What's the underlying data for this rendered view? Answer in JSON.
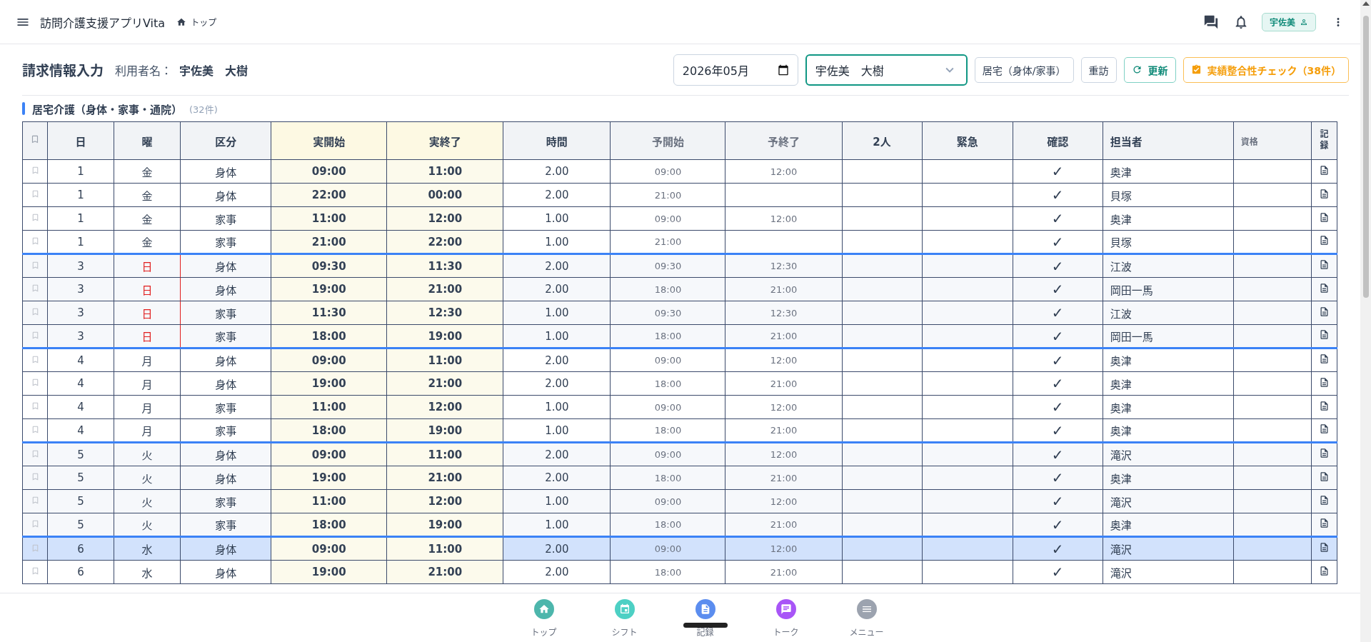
{
  "header": {
    "app_title": "訪問介護支援アプリVita",
    "breadcrumb": "トップ",
    "user_badge": "宇佐美"
  },
  "page": {
    "title": "請求情報入力",
    "user_label": "利用者名：",
    "user_name": "宇佐美　大樹"
  },
  "controls": {
    "month": "2026年05月",
    "user_select": "宇佐美　大樹",
    "buttons": [
      {
        "label": "居宅（身体/家事）",
        "kind": "outline"
      },
      {
        "label": "重訪",
        "kind": "outline"
      },
      {
        "label": "更新",
        "kind": "refresh"
      },
      {
        "label": "実績整合性チェック（38件）",
        "kind": "warning"
      }
    ]
  },
  "section": {
    "title": "居宅介護（身体・家事・通院）",
    "count": "(32件)"
  },
  "table": {
    "columns": [
      {
        "kind": "bookmark"
      },
      {
        "label": "日",
        "kind": "main"
      },
      {
        "label": "曜",
        "kind": "main"
      },
      {
        "label": "区分",
        "kind": "main"
      },
      {
        "label": "実開始",
        "kind": "actual"
      },
      {
        "label": "実終了",
        "kind": "actual"
      },
      {
        "label": "時間",
        "kind": "main"
      },
      {
        "label": "予開始",
        "kind": "plan"
      },
      {
        "label": "予終了",
        "kind": "plan"
      },
      {
        "label": "2人",
        "kind": "main"
      },
      {
        "label": "緊急",
        "kind": "main"
      },
      {
        "label": "確認",
        "kind": "main"
      },
      {
        "label": "担当者",
        "kind": "staff"
      },
      {
        "label": "資格",
        "kind": "minor"
      },
      {
        "label": "記録",
        "kind": "vertical"
      }
    ],
    "rows": [
      {
        "day": "1",
        "weekday": "金",
        "sunday": false,
        "category": "身体",
        "actual_start": "09:00",
        "actual_end": "11:00",
        "hours": "2.00",
        "plan_start": "09:00",
        "plan_end": "12:00",
        "confirmed": "✓",
        "staff": "奥津",
        "selected": false
      },
      {
        "day": "1",
        "weekday": "金",
        "sunday": false,
        "category": "身体",
        "actual_start": "22:00",
        "actual_end": "00:00",
        "hours": "2.00",
        "plan_start": "21:00",
        "confirmed": "✓",
        "staff": "貝塚",
        "selected": false
      },
      {
        "day": "1",
        "weekday": "金",
        "sunday": false,
        "category": "家事",
        "actual_start": "11:00",
        "actual_end": "12:00",
        "hours": "1.00",
        "plan_start": "09:00",
        "plan_end": "12:00",
        "confirmed": "✓",
        "staff": "奥津",
        "selected": false
      },
      {
        "day": "1",
        "weekday": "金",
        "sunday": false,
        "category": "家事",
        "actual_start": "21:00",
        "actual_end": "22:00",
        "hours": "1.00",
        "plan_start": "21:00",
        "confirmed": "✓",
        "staff": "貝塚",
        "selected": false
      },
      {
        "day": "3",
        "weekday": "日",
        "sunday": true,
        "category": "身体",
        "actual_start": "09:30",
        "actual_end": "11:30",
        "hours": "2.00",
        "plan_start": "09:30",
        "plan_end": "12:30",
        "confirmed": "✓",
        "staff": "江波",
        "selected": false
      },
      {
        "day": "3",
        "weekday": "日",
        "sunday": true,
        "category": "身体",
        "actual_start": "19:00",
        "actual_end": "21:00",
        "hours": "2.00",
        "plan_start": "18:00",
        "plan_end": "21:00",
        "confirmed": "✓",
        "staff": "岡田一馬",
        "selected": false
      },
      {
        "day": "3",
        "weekday": "日",
        "sunday": true,
        "category": "家事",
        "actual_start": "11:30",
        "actual_end": "12:30",
        "hours": "1.00",
        "plan_start": "09:30",
        "plan_end": "12:30",
        "confirmed": "✓",
        "staff": "江波",
        "selected": false
      },
      {
        "day": "3",
        "weekday": "日",
        "sunday": true,
        "category": "家事",
        "actual_start": "18:00",
        "actual_end": "19:00",
        "hours": "1.00",
        "plan_start": "18:00",
        "plan_end": "21:00",
        "confirmed": "✓",
        "staff": "岡田一馬",
        "selected": false
      },
      {
        "day": "4",
        "weekday": "月",
        "sunday": false,
        "category": "身体",
        "actual_start": "09:00",
        "actual_end": "11:00",
        "hours": "2.00",
        "plan_start": "09:00",
        "plan_end": "12:00",
        "confirmed": "✓",
        "staff": "奥津",
        "selected": false
      },
      {
        "day": "4",
        "weekday": "月",
        "sunday": false,
        "category": "身体",
        "actual_start": "19:00",
        "actual_end": "21:00",
        "hours": "2.00",
        "plan_start": "18:00",
        "plan_end": "21:00",
        "confirmed": "✓",
        "staff": "奥津",
        "selected": false
      },
      {
        "day": "4",
        "weekday": "月",
        "sunday": false,
        "category": "家事",
        "actual_start": "11:00",
        "actual_end": "12:00",
        "hours": "1.00",
        "plan_start": "09:00",
        "plan_end": "12:00",
        "confirmed": "✓",
        "staff": "奥津",
        "selected": false
      },
      {
        "day": "4",
        "weekday": "月",
        "sunday": false,
        "category": "家事",
        "actual_start": "18:00",
        "actual_end": "19:00",
        "hours": "1.00",
        "plan_start": "18:00",
        "plan_end": "21:00",
        "confirmed": "✓",
        "staff": "奥津",
        "selected": false
      },
      {
        "day": "5",
        "weekday": "火",
        "sunday": false,
        "category": "身体",
        "actual_start": "09:00",
        "actual_end": "11:00",
        "hours": "2.00",
        "plan_start": "09:00",
        "plan_end": "12:00",
        "confirmed": "✓",
        "staff": "滝沢",
        "selected": false
      },
      {
        "day": "5",
        "weekday": "火",
        "sunday": false,
        "category": "身体",
        "actual_start": "19:00",
        "actual_end": "21:00",
        "hours": "2.00",
        "plan_start": "18:00",
        "plan_end": "21:00",
        "confirmed": "✓",
        "staff": "奥津",
        "selected": false
      },
      {
        "day": "5",
        "weekday": "火",
        "sunday": false,
        "category": "家事",
        "actual_start": "11:00",
        "actual_end": "12:00",
        "hours": "1.00",
        "plan_start": "09:00",
        "plan_end": "12:00",
        "confirmed": "✓",
        "staff": "滝沢",
        "selected": false
      },
      {
        "day": "5",
        "weekday": "火",
        "sunday": false,
        "category": "家事",
        "actual_start": "18:00",
        "actual_end": "19:00",
        "hours": "1.00",
        "plan_start": "18:00",
        "plan_end": "21:00",
        "confirmed": "✓",
        "staff": "奥津",
        "selected": false
      },
      {
        "day": "6",
        "weekday": "水",
        "sunday": false,
        "category": "身体",
        "actual_start": "09:00",
        "actual_end": "11:00",
        "hours": "2.00",
        "plan_start": "09:00",
        "plan_end": "12:00",
        "confirmed": "✓",
        "staff": "滝沢",
        "selected": true
      },
      {
        "day": "6",
        "weekday": "水",
        "sunday": false,
        "category": "身体",
        "actual_start": "19:00",
        "actual_end": "21:00",
        "hours": "2.00",
        "plan_start": "18:00",
        "plan_end": "21:00",
        "confirmed": "✓",
        "staff": "滝沢",
        "selected": false
      }
    ]
  },
  "bottom_nav": [
    {
      "label": "トップ",
      "kind": "home",
      "color": "#4db6ac",
      "selected": false
    },
    {
      "label": "シフト",
      "kind": "calendar",
      "color": "#4dd0c4",
      "selected": false
    },
    {
      "label": "記録",
      "kind": "document",
      "color": "#5b8def",
      "selected": true
    },
    {
      "label": "トーク",
      "kind": "chat",
      "color": "#a855f7",
      "selected": false
    },
    {
      "label": "メニュー",
      "kind": "menu",
      "color": "#9ca3af",
      "selected": false
    }
  ]
}
